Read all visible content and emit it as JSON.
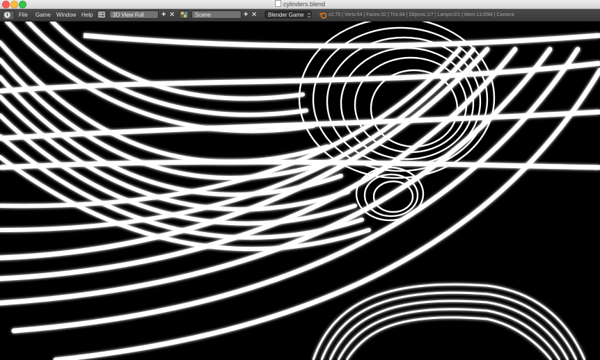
{
  "window": {
    "title": "cylinders.blend"
  },
  "menu": {
    "items": [
      "File",
      "Game",
      "Window",
      "Help"
    ]
  },
  "screen_layout": {
    "value": "3D View Full",
    "add_symbol": "+",
    "remove_symbol": "✕"
  },
  "scene": {
    "value": "Scene",
    "add_symbol": "+",
    "remove_symbol": "✕"
  },
  "engine": {
    "value": "Blender Game"
  },
  "stats": {
    "text": "v2.75 | Verts:64 | Faces:32 | Tris:64 | Objects:1/7 | Lamps:0/1 | Mem:13.65M | Camera"
  },
  "colors": {
    "header": "#404040",
    "viewport": "#000000",
    "tube": "#ffffff"
  }
}
